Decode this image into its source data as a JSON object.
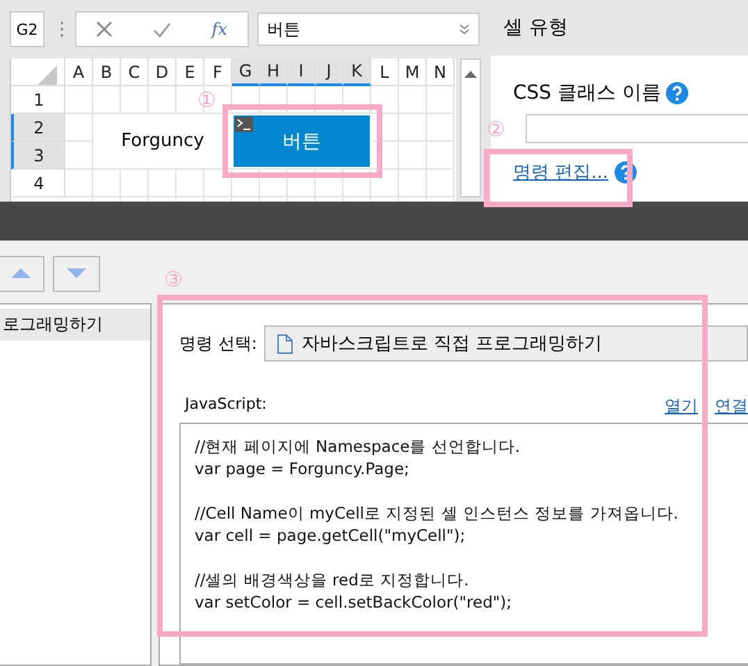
{
  "toolbar": {
    "name_box": "G2",
    "separator": "⋮",
    "function_label": "fx",
    "formula_value": "버튼"
  },
  "sheet": {
    "columns": [
      {
        "label": "A",
        "selected": false
      },
      {
        "label": "B",
        "selected": false
      },
      {
        "label": "C",
        "selected": false
      },
      {
        "label": "D",
        "selected": false
      },
      {
        "label": "E",
        "selected": false
      },
      {
        "label": "F",
        "selected": false
      },
      {
        "label": "G",
        "selected": true
      },
      {
        "label": "H",
        "selected": true
      },
      {
        "label": "I",
        "selected": true
      },
      {
        "label": "J",
        "selected": true
      },
      {
        "label": "K",
        "selected": true
      },
      {
        "label": "L",
        "selected": false
      },
      {
        "label": "M",
        "selected": false
      },
      {
        "label": "N",
        "selected": false
      }
    ],
    "rows": [
      {
        "label": "1",
        "selected": false
      },
      {
        "label": "2",
        "selected": true
      },
      {
        "label": "3",
        "selected": true
      },
      {
        "label": "4",
        "selected": false
      }
    ],
    "text_cell": "Forguncy",
    "button_label": "버튼"
  },
  "property_panel": {
    "title": "셀 유형",
    "css_label": "CSS 클래스 이름",
    "command_link": "명령 편집..."
  },
  "markers": [
    "①",
    "②",
    "③"
  ],
  "dialog": {
    "list_items": [
      {
        "label": "로그래밍하기",
        "selected": true
      }
    ],
    "command_label": "명령 선택:",
    "command_value": "자바스크립트로 직접 프로그래밍하기",
    "script_label": "JavaScript:",
    "links": [
      "열기",
      "연결"
    ],
    "code_blocks": [
      [
        "//현재 페이지에 Namespace를 선언합니다.",
        "var page = Forguncy.Page;"
      ],
      [
        "//Cell Name이 myCell로 지정된 셀 인스턴스 정보를 가져옵니다.",
        "var cell = page.getCell(\"myCell\");"
      ],
      [
        "//셀의 배경색상을 red로 지정합니다.",
        "var setColor = cell.setBackColor(\"red\");"
      ]
    ]
  }
}
